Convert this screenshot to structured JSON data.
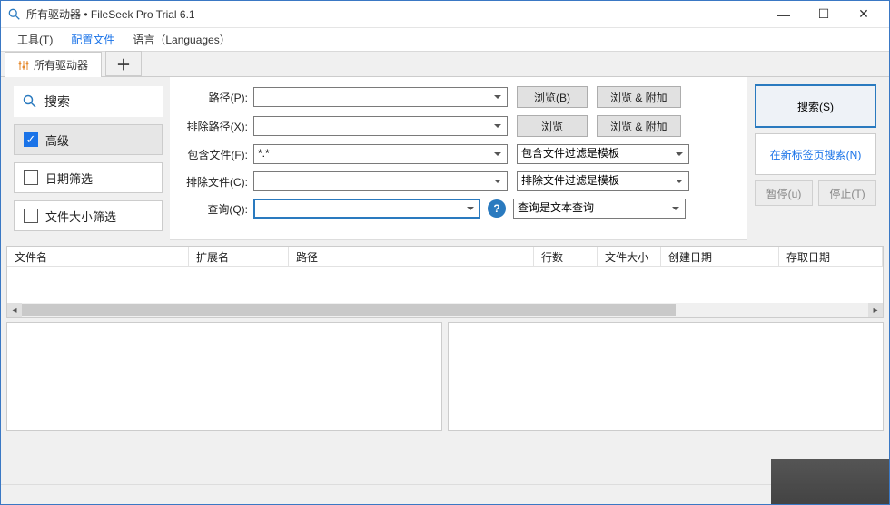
{
  "window": {
    "title": "所有驱动器 • FileSeek Pro Trial 6.1"
  },
  "win_buttons": {
    "min": "—",
    "max": "☐",
    "close": "✕"
  },
  "menu": {
    "tools": "工具(T)",
    "profiles": "配置文件",
    "lang": "语言（Languages）"
  },
  "tabs": {
    "main": "所有驱动器",
    "add": "＋"
  },
  "side": {
    "search": "搜索",
    "advanced": "高级",
    "date_filter": "日期筛选",
    "size_filter": "文件大小筛选",
    "advanced_checked": true
  },
  "form": {
    "path_label": "路径(P):",
    "exclude_path_label": "排除路径(X):",
    "include_file_label": "包含文件(F):",
    "include_file_value": "*.*",
    "exclude_file_label": "排除文件(C):",
    "query_label": "查询(Q):",
    "query_value": "",
    "browse_b": "浏览(B)",
    "browse_append": "浏览 & 附加",
    "browse": "浏览",
    "include_mode": "包含文件过滤是模板",
    "exclude_mode": "排除文件过滤是模板",
    "query_mode": "查询是文本查询"
  },
  "actions": {
    "search": "搜索(S)",
    "search_new_tab": "在新标签页搜索(N)",
    "pause": "暂停(u)",
    "stop": "停止(T)"
  },
  "grid": {
    "cols": {
      "filename": "文件名",
      "ext": "扩展名",
      "path": "路径",
      "lines": "行数",
      "size": "文件大小",
      "created": "创建日期",
      "accessed": "存取日期"
    }
  },
  "checkmark": "✓",
  "help": "?"
}
